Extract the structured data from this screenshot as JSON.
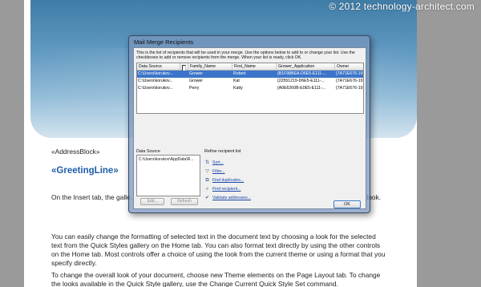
{
  "watermark": "© 2012 technology-architect.com",
  "document": {
    "address_block": "«AddressBlock»",
    "greeting_line": "«GreetingLine»",
    "paragraphs": [
      "On the Insert tab, the galle… document. You can use the… document building blocks… current document look.",
      "You can easily change the formatting of selected text in the document text by choosing a look for the selected text from the Quick Styles gallery on the Home tab. You can also format text directly by using the other controls on the Home tab. Most controls offer a choice of using the look from the current theme or using a format that you specify directly.",
      "To change the overall look of your document, choose new Theme elements on the Page Layout tab. To change the looks available in the Quick Style gallery, use the Change Current Quick Style Set command."
    ]
  },
  "dialog": {
    "title": "Mail Merge Recipients",
    "instructions": "This is the list of recipients that will be used in your merge. Use the options below to add to or change your list. Use the checkboxes to add or remove recipients from the merge. When your list is ready, click OK.",
    "columns": [
      "Data Source",
      "",
      "Family_Name",
      "First_Name",
      "Grower_Application",
      "Owner"
    ],
    "rows": [
      {
        "source": "C:\\Users\\korukov...",
        "checked": true,
        "family": "Grower",
        "first": "Robert",
        "app": "{B1F98BEA-D6E5-E111-...",
        "owner": "{7A71E676-19..."
      },
      {
        "source": "C:\\Users\\korukov...",
        "checked": true,
        "family": "Grower",
        "first": "Kat",
        "app": "{22551219-D6E5-E111-...",
        "owner": "{7A71E676-19..."
      },
      {
        "source": "C:\\Users\\korukov...",
        "checked": true,
        "family": "Perry",
        "first": "Katty",
        "app": "{A0E6260B-E0E5-E111-...",
        "owner": "{7A71E676-19..."
      }
    ],
    "data_source_label": "Data Source",
    "data_source_item": "C:\\Users\\korukov\\AppData\\R...",
    "edit_label": "Edit...",
    "refresh_label": "Refresh",
    "refine_label": "Refine recipient list",
    "refine_items": [
      {
        "icon": "sort-icon",
        "glyph": "⇅",
        "label": "Sort..."
      },
      {
        "icon": "filter-icon",
        "glyph": "▽",
        "label": "Filter..."
      },
      {
        "icon": "find-duplicates-icon",
        "glyph": "⧉",
        "label": "Find duplicates..."
      },
      {
        "icon": "find-recipient-icon",
        "glyph": "⌕",
        "label": "Find recipient..."
      },
      {
        "icon": "validate-addresses-icon",
        "glyph": "✔",
        "label": "Validate addresses..."
      }
    ],
    "ok_label": "OK"
  },
  "colors": {
    "selection": "#3b75c9",
    "greeting": "#1f5ea8",
    "link": "#1a47a8"
  }
}
